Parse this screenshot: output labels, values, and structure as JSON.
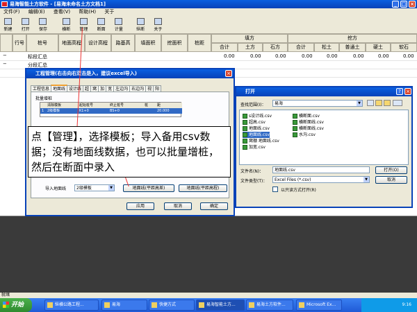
{
  "app": {
    "title": "易海智能土方软件 - [易海未命名土方文档1]"
  },
  "menu": [
    "文件(F)",
    "编辑(E)",
    "查看(V)",
    "帮助(H)",
    "关于"
  ],
  "toolbar": [
    "新建",
    "打开",
    "保存",
    "横断",
    "管理",
    "断面",
    "计量",
    "纵断",
    "关于"
  ],
  "grid": {
    "headers": [
      "行号",
      "桩号",
      "地面高程",
      "设计高程",
      "路基高",
      "填面积",
      "挖面积",
      "桩距"
    ],
    "group_fill": "填方",
    "group_cut": "挖方",
    "fill_cols": [
      "合计",
      "土方",
      "石方"
    ],
    "cut_cols": [
      "合计",
      "松土",
      "普通土",
      "硬土",
      "软石"
    ],
    "rows": [
      {
        "label": "标段汇总",
        "fill": [
          "0.00",
          "0.00",
          "0.00"
        ],
        "cut": [
          "0.00",
          "0.00",
          "0.00",
          "0.00",
          "0.00"
        ]
      },
      {
        "label": "分段汇总",
        "fill": [
          "0.00",
          "0.00",
          "0.00"
        ],
        "cut": [
          "0.00",
          "0.00",
          "0.00",
          "0.00",
          "0.00"
        ]
      }
    ]
  },
  "mgmt_dialog": {
    "title": "工程管理(右击向右双击是入，建议excel导入)",
    "tabs": [
      "工程信息",
      "地面线",
      "设计线",
      "超",
      "窝",
      "加",
      "宽",
      "左边沟",
      "右边沟",
      "视",
      "阳"
    ],
    "group": "批量增桩",
    "table_headers": [
      "清除模板",
      "起始桩号",
      "终止桩号",
      "桩",
      "距"
    ],
    "table_row": [
      "2级模板",
      "K1+0",
      "BS+0",
      "20.000"
    ],
    "import_label": "导入地面线",
    "template_value": "2级模板",
    "btn_import_1": "地面线(平距高差)",
    "btn_import_2": "地面线(平距高程)",
    "ok": "应用",
    "cancel": "取消",
    "confirm": "确定"
  },
  "open_dialog": {
    "title": "打开",
    "lookin_label": "查找范围(I)：",
    "lookin_value": "易海",
    "files": [
      "s设计线.csv",
      "超高.csv",
      "地面线.csv",
      "地面线.csv",
      "窝棚 地面线.csv",
      "加宽.csv",
      "横断面.csv",
      "横断面线.csv",
      "横断面线.csv",
      "水沟.csv"
    ],
    "filename_label": "文件名(N)：",
    "filename_value": "地面线.csv",
    "filetype_label": "文件类型(T)：",
    "filetype_value": "Excel Files (*.csv)",
    "readonly_label": "以只读方式打开(R)",
    "open_btn": "打开(O)",
    "cancel_btn": "取消"
  },
  "annotation": "点【管理】，选择模板；导入备用csv数据；没有地面线数据，也可以批量增桩，然后在断面中录入",
  "taskbar": {
    "start": "开始",
    "tasks": [
      "纵横公路工程...",
      "易海",
      "快捷方式",
      "易海智能土方...",
      "易海土方软件...",
      "Microsoft Ex..."
    ],
    "clock": "9:16"
  },
  "status": "就绪"
}
